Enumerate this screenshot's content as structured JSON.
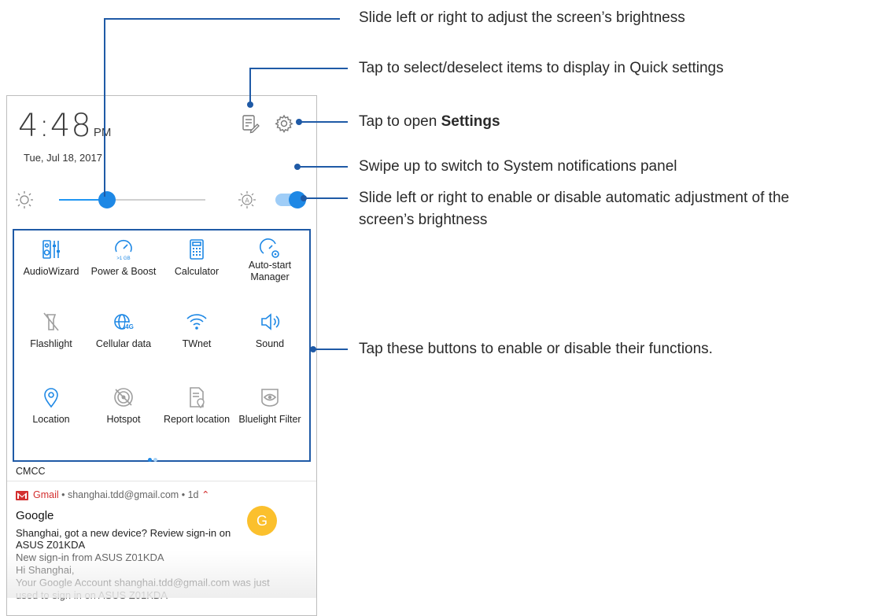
{
  "panel": {
    "time": "4:48",
    "ampm": "PM",
    "date": "Tue, Jul 18, 2017",
    "header_icons": [
      "edit-tiles-icon",
      "settings-gear-icon"
    ],
    "brightness": {
      "level": 0.33,
      "auto_enabled": true
    },
    "tiles": [
      {
        "label": "AudioWizard",
        "icon": "audiowizard-icon",
        "active": true
      },
      {
        "label": "Power & Boost",
        "icon": "power-boost-icon",
        "active": true,
        "badge": ">1 GB"
      },
      {
        "label": "Calculator",
        "icon": "calculator-icon",
        "active": true
      },
      {
        "label": "Auto-start\nManager",
        "icon": "auto-start-manager-icon",
        "active": true
      },
      {
        "label": "Flashlight",
        "icon": "flashlight-icon",
        "active": false
      },
      {
        "label": "Cellular data",
        "icon": "cellular-data-icon",
        "active": true,
        "badge": "4G"
      },
      {
        "label": "TWnet",
        "icon": "wifi-icon",
        "active": true
      },
      {
        "label": "Sound",
        "icon": "sound-icon",
        "active": true
      },
      {
        "label": "Location",
        "icon": "location-icon",
        "active": true
      },
      {
        "label": "Hotspot",
        "icon": "hotspot-icon",
        "active": false
      },
      {
        "label": "Report location",
        "icon": "report-location-icon",
        "active": false
      },
      {
        "label": "Bluelight Filter",
        "icon": "bluelight-filter-icon",
        "active": false
      }
    ],
    "page_dots": {
      "count": 2,
      "current": 1
    },
    "carrier": "CMCC",
    "notification": {
      "app": "Gmail",
      "account": "shanghai.tdd@gmail.com",
      "age": "1d",
      "avatar_letter": "G",
      "title": "Google",
      "lines": [
        "Shanghai, got a new device? Review sign-in on",
        "ASUS Z01KDA",
        "New sign-in from ASUS Z01KDA",
        "Hi Shanghai,",
        "Your Google Account shanghai.tdd@gmail.com was just",
        "used to sign in on ASUS Z01KDA"
      ]
    }
  },
  "callouts": {
    "brightness": "Slide left or right to adjust the screen’s brightness",
    "edit": "Tap to select/deselect items to display in Quick settings",
    "settings_prefix": "Tap to open ",
    "settings_bold": "Settings",
    "swipe": "Swipe up to switch to System notifications panel",
    "auto_line1": "Slide left or right to enable or disable automatic adjustment of the",
    "auto_line2": "screen’s brightness",
    "tiles": "Tap these buttons to enable or disable their functions."
  },
  "colors": {
    "accent": "#1e88e5",
    "callout_line": "#1f5aa6",
    "icon_active": "#1e88e5",
    "icon_inactive": "#9e9e9e",
    "gmail_red": "#d32f2f",
    "avatar": "#fbc02d"
  }
}
